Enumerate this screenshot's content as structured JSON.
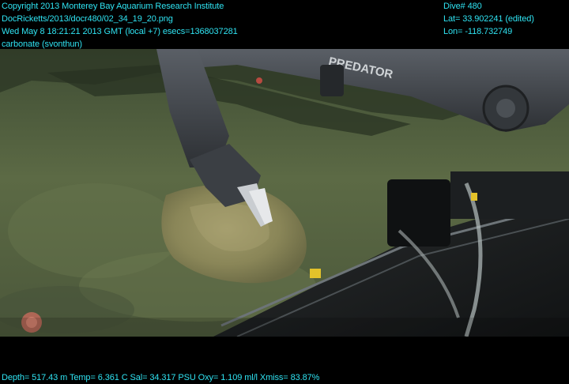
{
  "overlay": {
    "top_left": {
      "copyright": "Copyright 2013 Monterey Bay Aquarium Research Institute",
      "filename": "DocRicketts/2013/docr480/02_34_19_20.png",
      "timestamp": "Wed May  8 18:21:21 2013 GMT (local +7)  esecs=1368037281",
      "annotation": "carbonate (svonthun)"
    },
    "top_right": {
      "dive": "Dive# 480",
      "lat": "Lat= 33.902241 (edited)",
      "lon": "Lon= -118.732749"
    },
    "bottom": {
      "telemetry": "Depth= 517.43 m  Temp= 6.361 C  Sal= 34.317 PSU  Oxy= 1.109 ml/l  Xmiss= 83.87%"
    }
  },
  "scene": {
    "manipulator_label": "PREDATOR"
  },
  "colors": {
    "overlay_text": "#2fe3f2",
    "background": "#000000",
    "seafloor": "#5d6a45",
    "arm": "#3e4247"
  }
}
